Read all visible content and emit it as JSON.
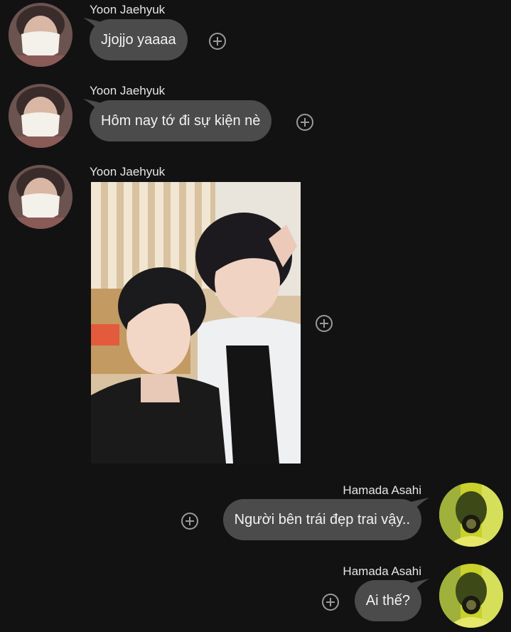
{
  "messages": [
    {
      "sender": "Yoon Jaehyuk",
      "text": "Jjojjo yaaaa"
    },
    {
      "sender": "Yoon Jaehyuk",
      "text": "Hôm nay tớ đi sự kiện nè"
    },
    {
      "sender": "Yoon Jaehyuk",
      "image": "selfie-photo"
    },
    {
      "sender": "Hamada Asahi",
      "text": "Người bên trái đẹp trai vậy.."
    },
    {
      "sender": "Hamada Asahi",
      "text": "Ai thế?"
    }
  ],
  "colors": {
    "background": "#121212",
    "bubble": "#4b4b4b",
    "text": "#f2f2f2",
    "add_icon": "#9a9a9a"
  },
  "icons": {
    "add": "plus-circle-icon"
  }
}
